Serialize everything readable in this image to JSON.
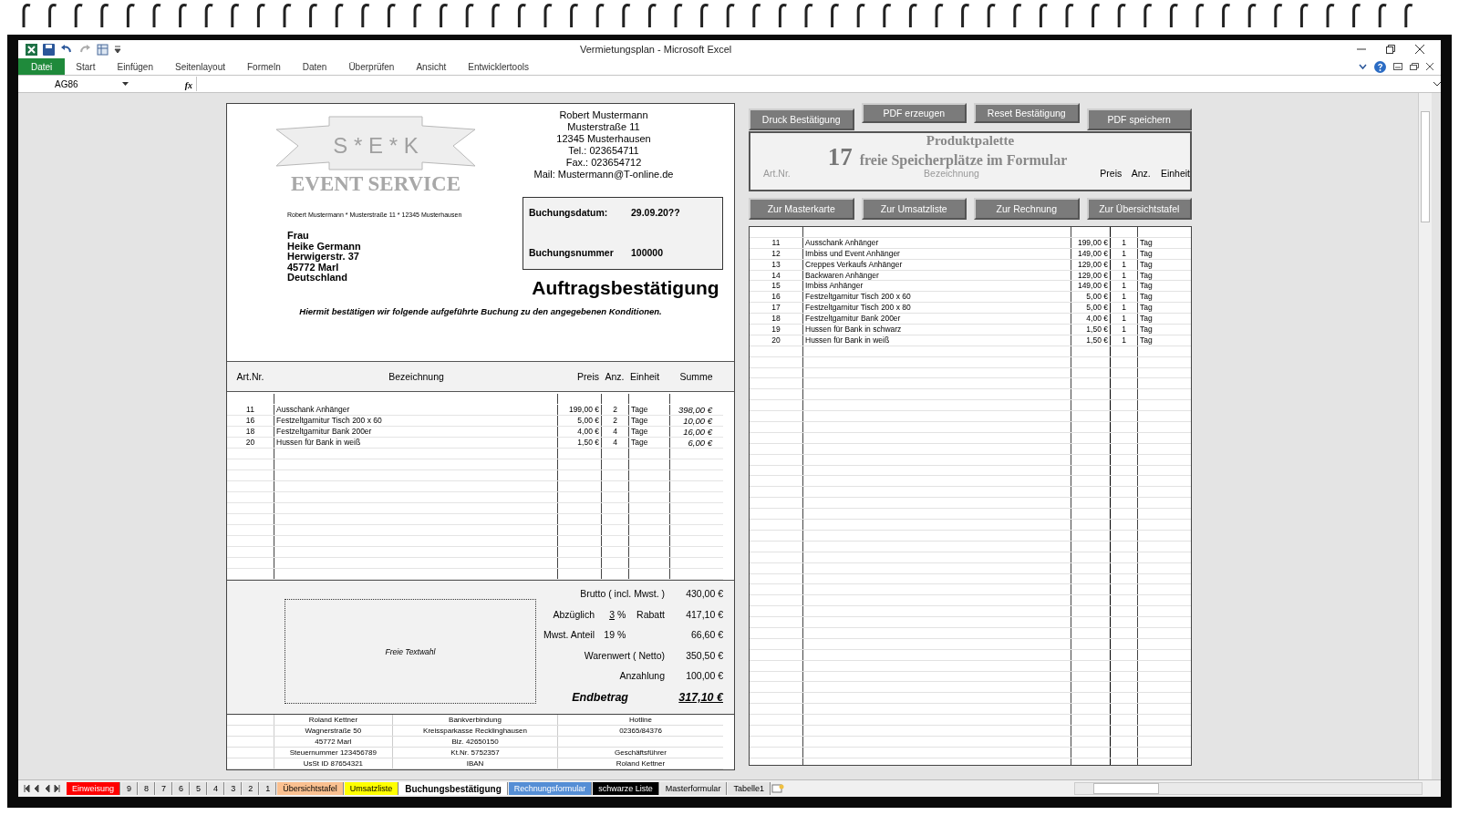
{
  "window": {
    "title": "Vermietungsplan  -  Microsoft Excel",
    "ribbon_tabs": [
      {
        "label": "Datei",
        "selected": true
      },
      {
        "label": "Start",
        "selected": false
      },
      {
        "label": "Einfügen",
        "selected": false
      },
      {
        "label": "Seitenlayout",
        "selected": false
      },
      {
        "label": "Formeln",
        "selected": false
      },
      {
        "label": "Daten",
        "selected": false
      },
      {
        "label": "Überprüfen",
        "selected": false
      },
      {
        "label": "Ansicht",
        "selected": false
      },
      {
        "label": "Entwicklertools",
        "selected": false
      }
    ],
    "name_box": "AG86",
    "fx_label": "fx"
  },
  "document": {
    "logo": {
      "banner_text": "S * E * K",
      "subtitle": "EVENT SERVICE"
    },
    "sender": [
      "Robert Mustermann",
      "Musterstraße 11",
      "12345 Musterhausen",
      "Tel.: 023654711",
      "Fax.: 023654712",
      "Mail: Mustermann@T-online.de"
    ],
    "return_address": "Robert Mustermann * Musterstraße 11 * 12345 Musterhausen",
    "recipient": [
      "Frau",
      "Heike Germann",
      "Herwigerstr. 37",
      "45772 Marl",
      "Deutschland"
    ],
    "booking": [
      {
        "label": "Buchungsdatum:",
        "value": "29.09.20??"
      },
      {
        "label": "Buchungsnummer",
        "value": "100000"
      }
    ],
    "heading": "Auftragsbestätigung",
    "intro": "Hiermit bestätigen wir folgende aufgeführte Buchung zu den angegebenen Konditionen.",
    "columns": [
      "Art.Nr.",
      "Bezeichnung",
      "Preis",
      "Anz.",
      "Einheit",
      "Summe"
    ],
    "rows": [
      {
        "nr": "11",
        "name": "Ausschank Anhänger",
        "price": "199,00 €",
        "qty": "2",
        "unit": "Tage",
        "sum": "398,00 €"
      },
      {
        "nr": "16",
        "name": "Festzeltgarnitur Tisch 200 x 60",
        "price": "5,00 €",
        "qty": "2",
        "unit": "Tage",
        "sum": "10,00 €"
      },
      {
        "nr": "18",
        "name": "Festzeltgarnitur Bank 200er",
        "price": "4,00 €",
        "qty": "4",
        "unit": "Tage",
        "sum": "16,00 €"
      },
      {
        "nr": "20",
        "name": "Hussen für Bank in weiß",
        "price": "1,50 €",
        "qty": "4",
        "unit": "Tage",
        "sum": "6,00 €"
      }
    ],
    "free_text": "Freie Textwahl",
    "totals": [
      {
        "kind": "plain",
        "label": "Brutto ( incl. Mwst. )",
        "value": "430,00 €"
      },
      {
        "kind": "percent",
        "label": "Abzüglich",
        "percent": "3",
        "unit": "%",
        "underlined": true,
        "label2": "Rabatt",
        "value": "417,10 €"
      },
      {
        "kind": "percent",
        "label": "Mwst. Anteil",
        "percent": "19",
        "unit": "%",
        "underlined": false,
        "value": "66,60 €"
      },
      {
        "kind": "plain",
        "label": "Warenwert ( Netto)",
        "value": "350,50 €"
      },
      {
        "kind": "plain",
        "label": "Anzahlung",
        "value": "100,00 €"
      },
      {
        "kind": "final",
        "label": "Endbetrag",
        "value": "317,10 €"
      }
    ],
    "footer": [
      {
        "left": "Roland Kettner",
        "middle": "Bankverbindung",
        "right": "Hotline"
      },
      {
        "left": "Wagnerstraße 50",
        "middle": "Kreissparkasse Recklinghausen",
        "right": "02365/84376"
      },
      {
        "left": "45772 Marl",
        "middle": "Blz. 42650150"
      },
      {
        "left": "Steuernummer 123456789",
        "middle": "Kt.Nr. 5752357",
        "right": "Geschäftsführer"
      },
      {
        "left": "UsSt ID 87654321",
        "middle": "IBAN",
        "right": "Roland Kettner"
      }
    ]
  },
  "panel": {
    "top_buttons": [
      "Druck Bestätigung",
      "PDF erzeugen",
      "Reset Bestätigung",
      "PDF speichern"
    ],
    "palette_title": "Produktpalette",
    "free_count": "17",
    "free_label": "freie Speicherplätze im Formular",
    "columns": [
      "Art.Nr.",
      "Bezeichnung",
      "Preis",
      "Anz.",
      "Einheit"
    ],
    "nav_buttons": [
      "Zur Masterkarte",
      "Zur Umsatzliste",
      "Zur Rechnung",
      "Zur Übersichtstafel"
    ],
    "products": [
      {
        "nr": "11",
        "name": "Ausschank Anhänger",
        "price": "199,00 €",
        "qty": "1",
        "unit": "Tag"
      },
      {
        "nr": "12",
        "name": "Imbiss und Event Anhänger",
        "price": "149,00 €",
        "qty": "1",
        "unit": "Tag"
      },
      {
        "nr": "13",
        "name": "Creppes Verkaufs Anhänger",
        "price": "129,00 €",
        "qty": "1",
        "unit": "Tag"
      },
      {
        "nr": "14",
        "name": "Backwaren Anhänger",
        "price": "129,00 €",
        "qty": "1",
        "unit": "Tag"
      },
      {
        "nr": "15",
        "name": "Imbiss Anhänger",
        "price": "149,00 €",
        "qty": "1",
        "unit": "Tag"
      },
      {
        "nr": "16",
        "name": "Festzeltgarnitur Tisch 200 x 60",
        "price": "5,00 €",
        "qty": "1",
        "unit": "Tag"
      },
      {
        "nr": "17",
        "name": "Festzeltgarnitur Tisch 200 x 80",
        "price": "5,00 €",
        "qty": "1",
        "unit": "Tag"
      },
      {
        "nr": "18",
        "name": "Festzeltgarnitur Bank 200er",
        "price": "4,00 €",
        "qty": "1",
        "unit": "Tag"
      },
      {
        "nr": "19",
        "name": "Hussen für Bank in schwarz",
        "price": "1,50 €",
        "qty": "1",
        "unit": "Tag"
      },
      {
        "nr": "20",
        "name": "Hussen für Bank in weiß",
        "price": "1,50 €",
        "qty": "1",
        "unit": "Tag"
      }
    ]
  },
  "sheet_tabs": [
    {
      "label": "Einweisung",
      "color": "#ff0000",
      "selected": false
    },
    {
      "label": "9",
      "selected": false
    },
    {
      "label": "8",
      "selected": false
    },
    {
      "label": "7",
      "selected": false
    },
    {
      "label": "6",
      "selected": false
    },
    {
      "label": "5",
      "selected": false
    },
    {
      "label": "4",
      "selected": false
    },
    {
      "label": "3",
      "selected": false
    },
    {
      "label": "2",
      "selected": false
    },
    {
      "label": "1",
      "selected": false
    },
    {
      "label": "Übersichtstafel",
      "color": "#fac090",
      "selected": false
    },
    {
      "label": "Umsatzliste",
      "color": "#ffff00",
      "selected": false
    },
    {
      "label": "Buchungsbestätigung",
      "selected": true
    },
    {
      "label": "Rechnungsformular",
      "color": "#558ed5",
      "selected": false
    },
    {
      "label": "schwarze Liste",
      "color": "#000000",
      "selected": false
    },
    {
      "label": "Masterformular",
      "selected": false
    },
    {
      "label": "Tabelle1",
      "selected": false
    }
  ]
}
